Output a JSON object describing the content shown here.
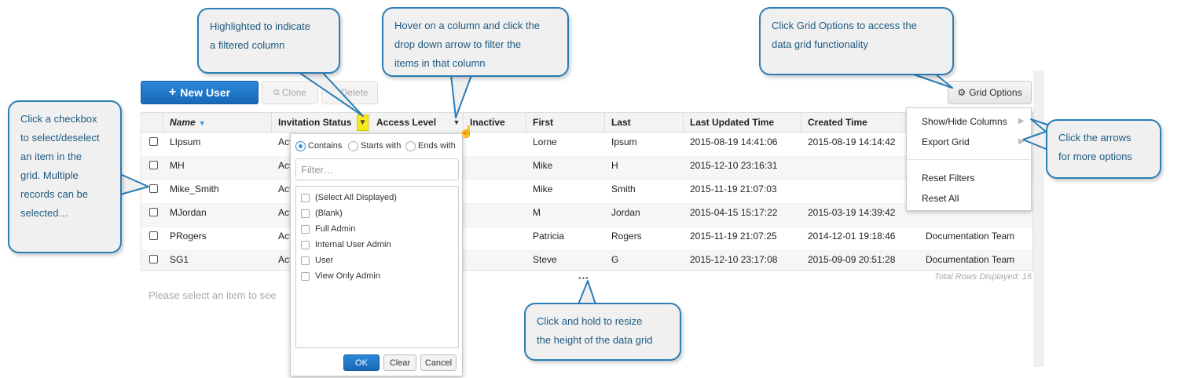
{
  "toolbar": {
    "new_user": "New User",
    "clone": "Clone",
    "delete": "Delete",
    "grid_options": "Grid Options"
  },
  "grid": {
    "columns": [
      "Name",
      "Invitation Status",
      "Access Level",
      "Inactive",
      "First",
      "Last",
      "Last Updated Time",
      "Created Time"
    ],
    "rows": [
      {
        "name": "LIpsum",
        "status": "Act",
        "first": "Lorne",
        "last": "Ipsum",
        "updated": "2015-08-19 14:41:06",
        "created": "2015-08-19 14:14:42",
        "team": ""
      },
      {
        "name": "MH",
        "status": "Act",
        "first": "Mike",
        "last": "H",
        "updated": "2015-12-10 23:16:31",
        "created": "",
        "team": ""
      },
      {
        "name": "Mike_Smith",
        "status": "Act",
        "first": "Mike",
        "last": "Smith",
        "updated": "2015-11-19 21:07:03",
        "created": "",
        "team": ""
      },
      {
        "name": "MJordan",
        "status": "Act",
        "first": "M",
        "last": "Jordan",
        "updated": "2015-04-15 15:17:22",
        "created": "2015-03-19 14:39:42",
        "team": ""
      },
      {
        "name": "PRogers",
        "status": "Act",
        "first": "Patricia",
        "last": "Rogers",
        "updated": "2015-11-19 21:07:25",
        "created": "2014-12-01 19:18:46",
        "team": "Documentation Team"
      },
      {
        "name": "SG1",
        "status": "Act",
        "first": "Steve",
        "last": "G",
        "updated": "2015-12-10 23:17:08",
        "created": "2015-09-09 20:51:28",
        "team": "Documentation Team"
      }
    ],
    "total_rows": "Total Rows Displayed: 16",
    "resize_handle": "•••",
    "select_message": "Please select an item to see"
  },
  "filter_popup": {
    "modes": [
      "Contains",
      "Starts with",
      "Ends with"
    ],
    "selected_mode": "Contains",
    "placeholder": "Filter…",
    "options": [
      "(Select All Displayed)",
      "(Blank)",
      "Full Admin",
      "Internal User Admin",
      "User",
      "View Only Admin"
    ],
    "ok": "OK",
    "clear": "Clear",
    "cancel": "Cancel"
  },
  "grid_menu": {
    "items": [
      "Show/Hide Columns",
      "Export Grid",
      "Reset Filters",
      "Reset All"
    ]
  },
  "callouts": {
    "highlighted": "Highlighted to indicate\na filtered column",
    "hover": "Hover on a column and click the\ndrop down arrow to filter the\nitems in that column",
    "grid_options": "Click Grid Options to access the\ndata grid functionality",
    "checkbox": "Click a checkbox\nto select/deselect\nan item in the\ngrid. Multiple\nrecords can be\nselected…",
    "arrows": "Click the arrows\nfor more options",
    "resize": "Click and hold to resize\nthe height of the data grid"
  },
  "colors": {
    "accent": "#1f74c4",
    "callout_border": "#2a7db5",
    "callout_text": "#1e5a82",
    "filter_highlight": "#f8ea1a"
  }
}
